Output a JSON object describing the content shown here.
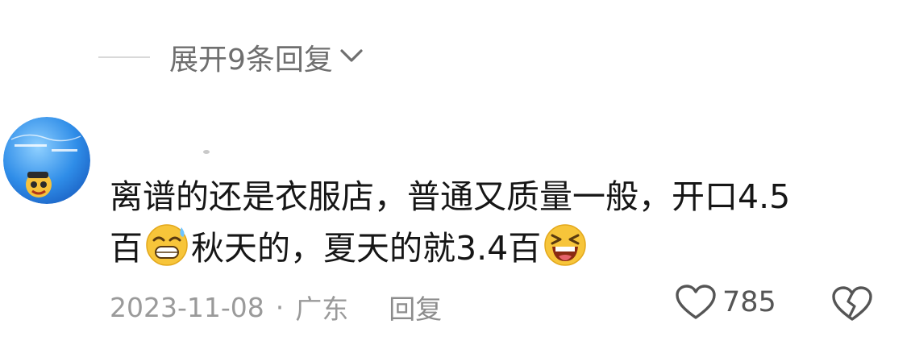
{
  "expand": {
    "label": "展开9条回复"
  },
  "comment": {
    "line1": "离谱的还是衣服店，普通又质量一般，开口4.5",
    "line2_a": "百",
    "line2_b": "秋天的，夏天的就3.4百",
    "emojis": [
      "grinning-sweat-emoji",
      "laughing-squint-emoji"
    ]
  },
  "meta": {
    "date": "2023-11-08",
    "separator": "·",
    "location": "广东",
    "reply_label": "回复"
  },
  "like": {
    "count": "785",
    "icon": "heart-outline-icon"
  },
  "dislike": {
    "icon": "broken-heart-icon"
  },
  "colors": {
    "text": "#161616",
    "muted": "#9a9a9a",
    "divider": "#d9d9d9"
  }
}
